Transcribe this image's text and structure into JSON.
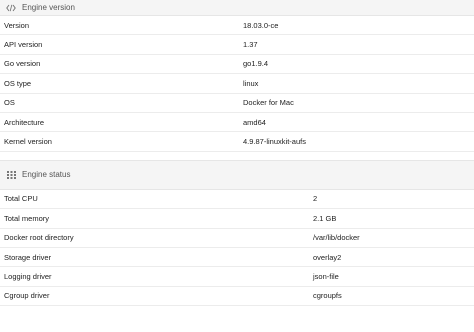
{
  "engine_version": {
    "title": "Engine version",
    "icon": "code-icon",
    "rows": [
      {
        "key": "Version",
        "value": "18.03.0-ce"
      },
      {
        "key": "API version",
        "value": "1.37"
      },
      {
        "key": "Go version",
        "value": "go1.9.4"
      },
      {
        "key": "OS type",
        "value": "linux"
      },
      {
        "key": "OS",
        "value": "Docker for Mac"
      },
      {
        "key": "Architecture",
        "value": "amd64"
      },
      {
        "key": "Kernel version",
        "value": "4.9.87-linuxkit-aufs"
      }
    ]
  },
  "engine_status": {
    "title": "Engine status",
    "icon": "grid-icon",
    "rows": [
      {
        "key": "Total CPU",
        "value": "2"
      },
      {
        "key": "Total memory",
        "value": "2.1 GB"
      },
      {
        "key": "Docker root directory",
        "value": "/var/lib/docker"
      },
      {
        "key": "Storage driver",
        "value": "overlay2"
      },
      {
        "key": "Logging driver",
        "value": "json-file"
      },
      {
        "key": "Cgroup driver",
        "value": "cgroupfs"
      }
    ]
  }
}
